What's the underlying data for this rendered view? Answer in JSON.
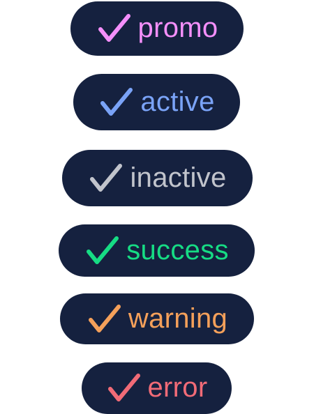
{
  "badges": [
    {
      "label": "promo",
      "color": "#f48ffa"
    },
    {
      "label": "active",
      "color": "#7aa3f7"
    },
    {
      "label": "inactive",
      "color": "#c1c4cc"
    },
    {
      "label": "success",
      "color": "#16dc84"
    },
    {
      "label": "warning",
      "color": "#f4a05a"
    },
    {
      "label": "error",
      "color": "#f16b77"
    }
  ],
  "badge_background": "#15213f",
  "icon_name": "checkmark-icon"
}
